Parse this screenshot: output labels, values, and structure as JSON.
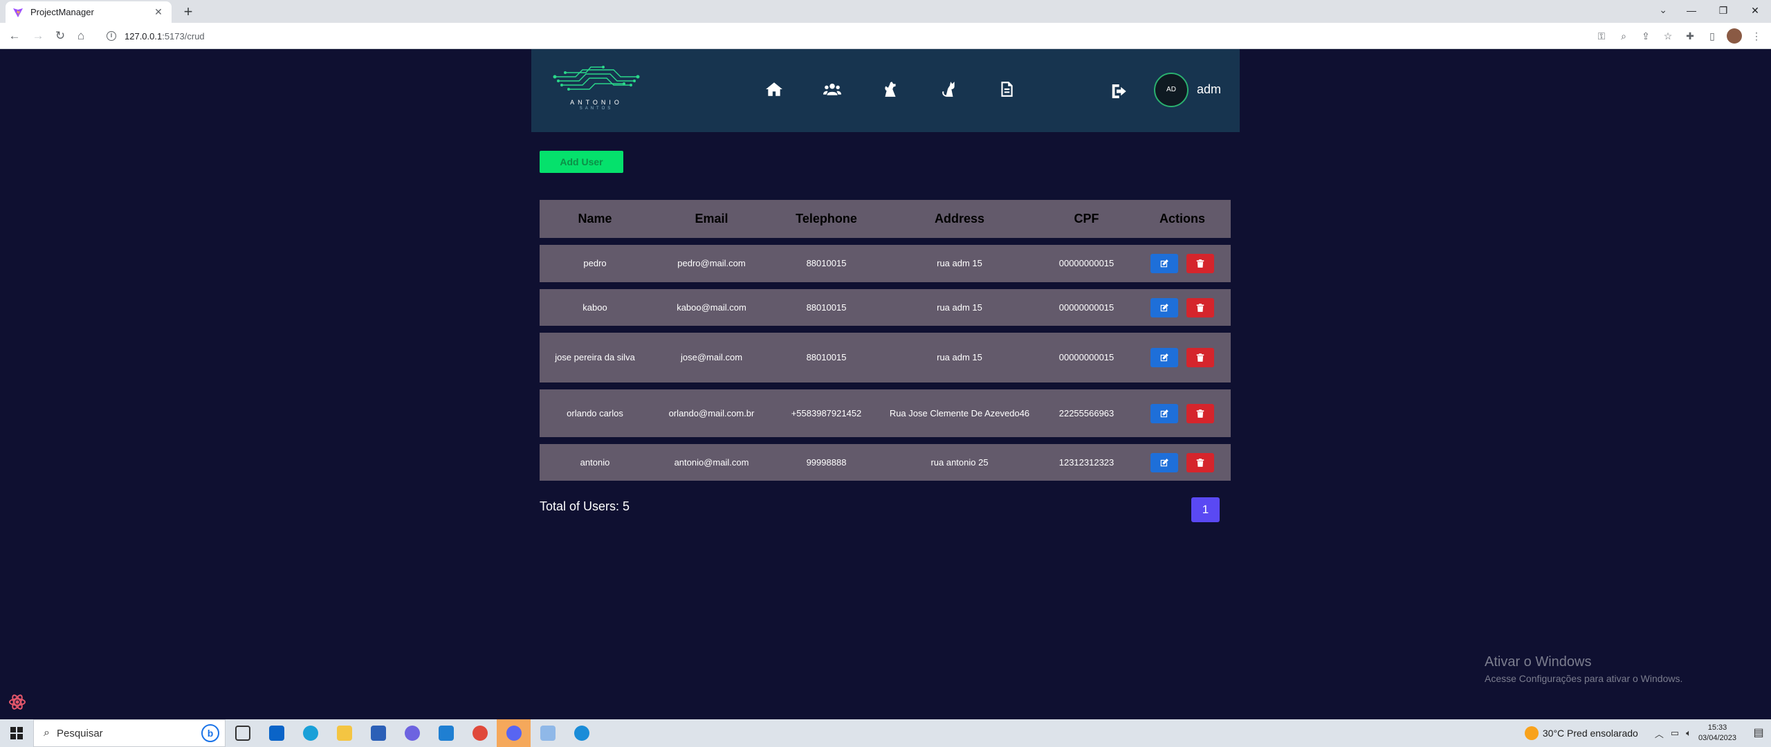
{
  "browser": {
    "tab_title": "ProjectManager",
    "tab_close": "✕",
    "new_tab": "+",
    "url_host": "127.0.0.1",
    "url_path": ":5173/crud"
  },
  "header": {
    "brand": "ANTONIO",
    "brand_sub": "SANTOS",
    "nav_icons": [
      "home-icon",
      "users-icon",
      "dog-icon",
      "cat-icon",
      "report-icon"
    ],
    "avatar_initials": "AD",
    "username": "adm"
  },
  "actions": {
    "add_user_label": "Add User"
  },
  "table": {
    "columns": [
      "Name",
      "Email",
      "Telephone",
      "Address",
      "CPF",
      "Actions"
    ],
    "rows": [
      {
        "name": "pedro",
        "email": "pedro@mail.com",
        "telephone": "88010015",
        "address": "rua adm 15",
        "cpf": "00000000015"
      },
      {
        "name": "kaboo",
        "email": "kaboo@mail.com",
        "telephone": "88010015",
        "address": "rua adm 15",
        "cpf": "00000000015"
      },
      {
        "name": "jose pereira da silva",
        "email": "jose@mail.com",
        "telephone": "88010015",
        "address": "rua adm 15",
        "cpf": "00000000015"
      },
      {
        "name": "orlando carlos",
        "email": "orlando@mail.com.br",
        "telephone": "+5583987921452",
        "address": "Rua Jose Clemente De Azevedo46",
        "cpf": "22255566963"
      },
      {
        "name": "antonio",
        "email": "antonio@mail.com",
        "telephone": "99998888",
        "address": "rua antonio 25",
        "cpf": "12312312323"
      }
    ]
  },
  "footer": {
    "total_label": "Total of Users: 5",
    "current_page": "1"
  },
  "watermark": {
    "line1": "Ativar o Windows",
    "line2": "Acesse Configurações para ativar o Windows."
  },
  "taskbar": {
    "search_placeholder": "Pesquisar",
    "weather": "30°C  Pred ensolarado",
    "time": "15:33",
    "date": "03/04/2023"
  },
  "colors": {
    "page_bg": "#0f1031",
    "header_bg": "#17344f",
    "row_bg": "#635a6b",
    "add_button": "#05e16c",
    "edit_button": "#1e6fd9",
    "delete_button": "#d5252c",
    "pagination": "#5a49f3"
  }
}
